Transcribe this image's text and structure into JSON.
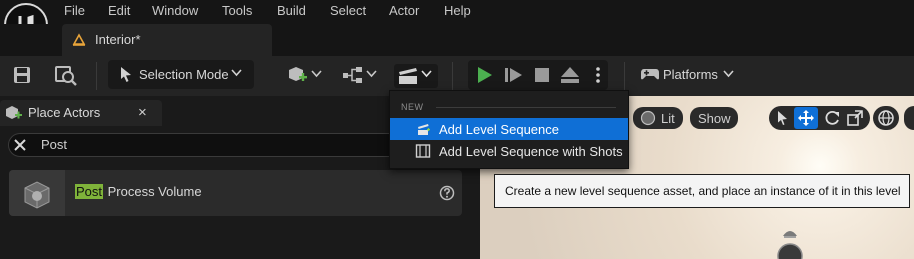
{
  "menubar": {
    "items": [
      "File",
      "Edit",
      "Window",
      "Tools",
      "Build",
      "Select",
      "Actor",
      "Help"
    ]
  },
  "document_tab": {
    "label": "Interior*"
  },
  "toolbar": {
    "selection_mode": "Selection Mode",
    "platforms": "Platforms"
  },
  "place_actors": {
    "tab_label": "Place Actors",
    "close_glyph": "×",
    "search_value": "Post",
    "result": {
      "match": "Post",
      "rest": " Process Volume"
    }
  },
  "viewport": {
    "lit_label": "Lit",
    "show_label": "Show"
  },
  "dropdown": {
    "section": "NEW",
    "items": [
      "Add Level Sequence",
      "Add Level Sequence with Shots"
    ]
  },
  "tooltip": {
    "text": "Create a new level sequence asset, and place an instance of it in this level"
  },
  "colors": {
    "accent": "#0f6fd6",
    "play_green": "#4caf50",
    "highlight": "#7fb33a",
    "tab_underline": "#e8a43a"
  }
}
